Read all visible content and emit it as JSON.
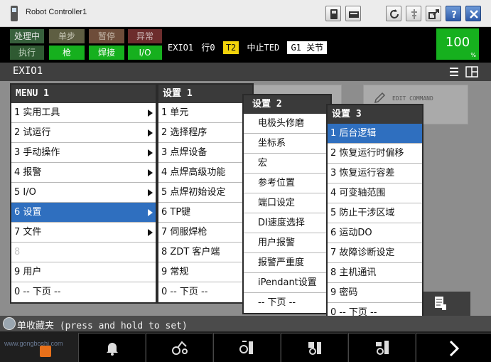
{
  "window": {
    "title": "Robot Controller1"
  },
  "status": {
    "row1": [
      "处理中",
      "单步",
      "暂停",
      "异常"
    ],
    "row2": [
      "执行",
      "枪",
      "焊接",
      "I/O"
    ],
    "program": "EXIO1",
    "line": "行0",
    "mode": "T2",
    "state": "中止TED",
    "group": "G1",
    "joint": "关节",
    "override": "100",
    "override_unit": "%"
  },
  "screen": {
    "name": "EXIO1"
  },
  "main_menu": {
    "header": "MENU  1",
    "items": [
      "1 实用工具",
      "2 试运行",
      "3 手动操作",
      "4 报警",
      "5 I/O",
      "6 设置",
      "7 文件",
      "8",
      "9 用户",
      "0 -- 下页 --"
    ]
  },
  "setup1": {
    "header": "设置  1",
    "items": [
      "1 单元",
      "2 选择程序",
      "3 点焊设备",
      "4 点焊高级功能",
      "5 点焊初始设定",
      "6 TP键",
      "7 伺服焊枪",
      "8 ZDT 客户端",
      "9 常规",
      "0 -- 下页 --"
    ]
  },
  "setup2": {
    "header": "设置  2",
    "items": [
      "电极头修磨",
      "坐标系",
      "宏",
      "参考位置",
      "端口设定",
      "DI速度选择",
      "用户报警",
      "报警严重度",
      "iPendant设置",
      "-- 下页 --"
    ]
  },
  "setup3": {
    "header": "设置  3",
    "items": [
      "1 后台逻辑",
      "2 恢复运行时偏移",
      "3 恢复运行容差",
      "4 可变轴范围",
      "5 防止干涉区域",
      "6 运动DO",
      "7 故障诊断设定",
      "8 主机通讯",
      "9 密码",
      "0 -- 下页 --"
    ]
  },
  "background": {
    "command_tile": "EDIT COMMAND"
  },
  "message": "单收藏夹 (press and hold to set)",
  "watermark": "www.gongboshi.com",
  "colors": {
    "selected": "#2f6fbf",
    "on": "#16b01e",
    "mode_badge": "#f2d30b"
  }
}
